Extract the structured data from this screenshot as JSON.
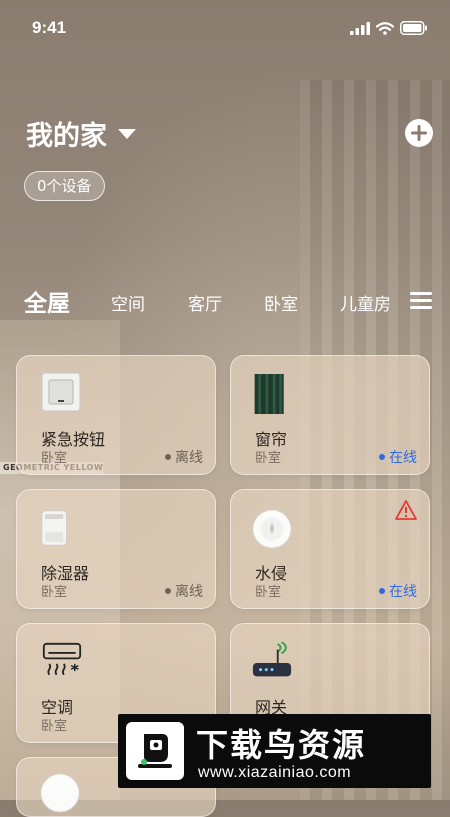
{
  "status_bar": {
    "time": "9:41"
  },
  "header": {
    "home_name": "我的家",
    "device_count": "0个设备"
  },
  "tabs": [
    {
      "label": "全屋",
      "active": true
    },
    {
      "label": "空间",
      "active": false
    },
    {
      "label": "客厅",
      "active": false
    },
    {
      "label": "卧室",
      "active": false
    },
    {
      "label": "儿童房",
      "active": false
    }
  ],
  "background": {
    "poster_text": "GEOMETRIC YELLOW"
  },
  "devices": [
    {
      "name": "紧急按钮",
      "room": "卧室",
      "status": "离线",
      "online": false,
      "icon": "emergency-button-icon"
    },
    {
      "name": "窗帘",
      "room": "卧室",
      "status": "在线",
      "online": true,
      "icon": "curtain-icon"
    },
    {
      "name": "除湿器",
      "room": "卧室",
      "status": "离线",
      "online": false,
      "icon": "dehumidifier-icon"
    },
    {
      "name": "水侵",
      "room": "卧室",
      "status": "在线",
      "online": true,
      "icon": "water-sensor-icon",
      "alert": true
    },
    {
      "name": "空调",
      "room": "卧室",
      "icon": "air-conditioner-icon"
    },
    {
      "name": "网关",
      "room": "",
      "icon": "gateway-icon"
    }
  ],
  "watermark": {
    "title": "下载鸟资源",
    "url": "www.xiazainiao.com"
  },
  "colors": {
    "online": "#2f6be0",
    "offline": "#6d6258",
    "alert": "#e53935"
  }
}
